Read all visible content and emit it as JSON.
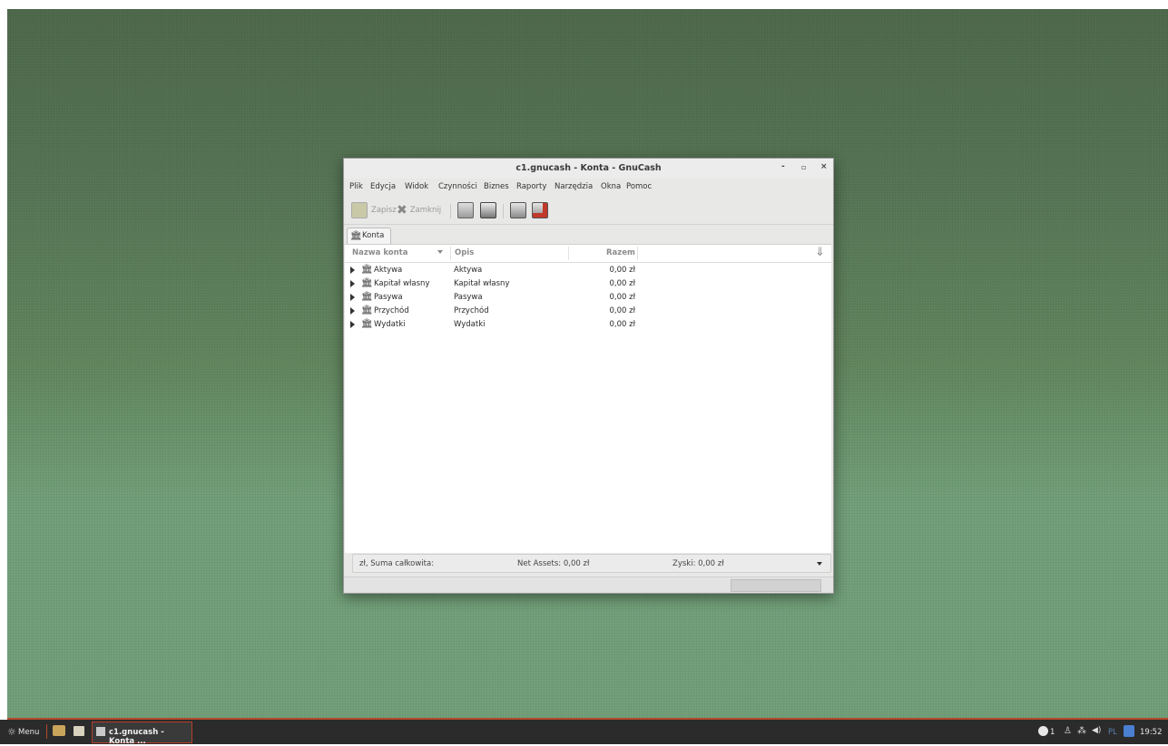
{
  "window": {
    "title": "c1.gnucash - Konta - GnuCash",
    "controls": {
      "minimize": "-",
      "maximize": "▫",
      "close": "×"
    }
  },
  "menu": [
    "Plik",
    "Edycja",
    "Widok",
    "Czynności",
    "Biznes",
    "Raporty",
    "Narzędzia",
    "Okna",
    "Pomoc"
  ],
  "toolbar": {
    "save_label": "Zapisz",
    "close_label": "Zamknij",
    "icons": [
      "save-icon",
      "close-x-icon",
      "open-folder-icon",
      "account-icon",
      "new-account-icon",
      "delete-account-icon"
    ]
  },
  "tab": {
    "label": "Konta"
  },
  "columns": {
    "name": "Nazwa konta",
    "description": "Opis",
    "total": "Razem"
  },
  "accounts": [
    {
      "name": "Aktywa",
      "description": "Aktywa",
      "total": "0,00 zł"
    },
    {
      "name": "Kapitał własny",
      "description": "Kapitał własny",
      "total": "0,00 zł"
    },
    {
      "name": "Pasywa",
      "description": "Pasywa",
      "total": "0,00 zł"
    },
    {
      "name": "Przychód",
      "description": "Przychód",
      "total": "0,00 zł"
    },
    {
      "name": "Wydatki",
      "description": "Wydatki",
      "total": "0,00 zł"
    }
  ],
  "summary": {
    "label": "zł, Suma całkowita:",
    "net_assets": "Net Assets: 0,00 zł",
    "profits": "Zyski: 0,00 zł"
  },
  "taskbar": {
    "menu_label": "Menu",
    "task_label": "c1.gnucash - Konta ...",
    "notifications": "1",
    "keyboard_layout": "PL",
    "clock": "19:52"
  },
  "colors": {
    "accent_red": "#b34a2a",
    "desktop_top": "#4f6a4d",
    "desktop_bottom": "#73a07a"
  }
}
